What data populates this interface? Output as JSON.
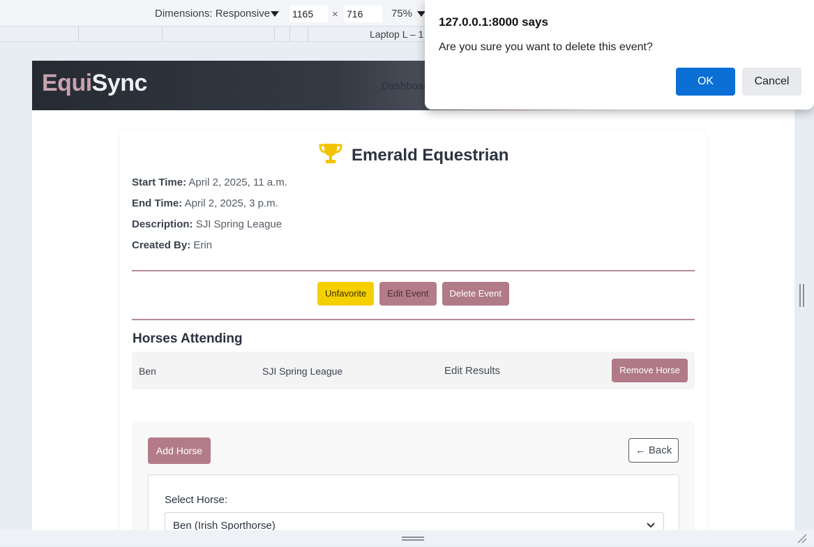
{
  "devtools": {
    "dimensions_label": "Dimensions: Responsive",
    "width_value": "1165",
    "times_symbol": "×",
    "height_value": "716",
    "zoom": "75%",
    "device_preset": "Laptop L – 1"
  },
  "navbar": {
    "brand_part1": "Equi",
    "brand_part2": "Sync",
    "links": [
      "Dashboar"
    ]
  },
  "event": {
    "title": "Emerald Equestrian",
    "details": [
      {
        "label": "Start Time:",
        "value": "April 2, 2025, 11 a.m."
      },
      {
        "label": "End Time:",
        "value": "April 2, 2025, 3 p.m."
      },
      {
        "label": "Description:",
        "value": "SJI Spring League"
      },
      {
        "label": "Created By:",
        "value": "Erin"
      }
    ],
    "actions": {
      "unfavorite": "Unfavorite",
      "edit": "Edit Event",
      "delete": "Delete Event"
    }
  },
  "horses_section": {
    "heading": "Horses Attending",
    "rows": [
      {
        "name": "Ben",
        "event": "SJI Spring League",
        "results_link": "Edit Results",
        "remove_label": "Remove Horse"
      }
    ]
  },
  "add_horse": {
    "add_label": "Add Horse",
    "back_label": "← Back",
    "select_label": "Select Horse:",
    "select_value": "Ben (Irish Sporthorse)"
  },
  "dialog": {
    "title": "127.0.0.1:8000 says",
    "message": "Are you sure you want to delete this event?",
    "ok_label": "OK",
    "cancel_label": "Cancel"
  },
  "icons": {
    "title_icon": "trophy-icon",
    "select_icon": "chevron-down-icon"
  },
  "colors": {
    "accent": "#b07a86",
    "favorite": "#f5cf00",
    "dialog_ok": "#0b6fd6",
    "trophy": "#f2c300"
  }
}
